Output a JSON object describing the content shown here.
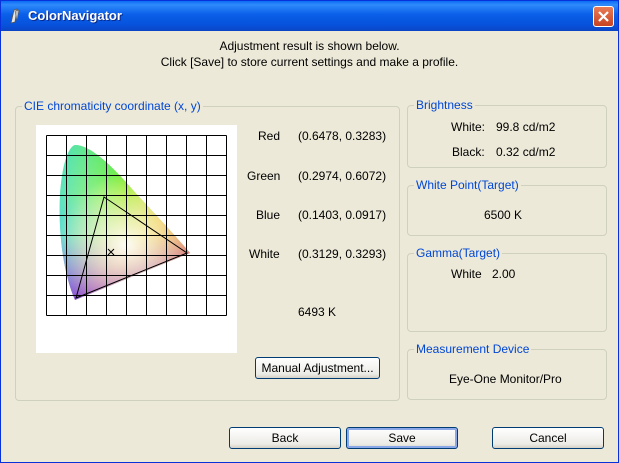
{
  "window": {
    "title": "ColorNavigator"
  },
  "message": {
    "line1": "Adjustment result is shown below.",
    "line2": "Click [Save] to store current settings and make a profile."
  },
  "cie": {
    "group_label": "CIE chromaticity coordinate (x, y)",
    "rows": [
      {
        "label": "Red",
        "value": "(0.6478, 0.3283)"
      },
      {
        "label": "Green",
        "value": "(0.2974, 0.6072)"
      },
      {
        "label": "Blue",
        "value": "(0.1403, 0.0917)"
      },
      {
        "label": "White",
        "value": "(0.3129, 0.3293)"
      }
    ],
    "color_temp": "6493 K",
    "manual_button": "Manual Adjustment..."
  },
  "brightness": {
    "group_label": "Brightness",
    "white_label": "White:",
    "white_value": "99.8 cd/m2",
    "black_label": "Black:",
    "black_value": "0.32 cd/m2"
  },
  "white_point": {
    "group_label": "White Point(Target)",
    "value": "6500 K"
  },
  "gamma": {
    "group_label": "Gamma(Target)",
    "label": "White",
    "value": "2.00"
  },
  "device": {
    "group_label": "Measurement Device",
    "value": "Eye-One Monitor/Pro"
  },
  "buttons": {
    "back": "Back",
    "save": "Save",
    "cancel": "Cancel"
  }
}
